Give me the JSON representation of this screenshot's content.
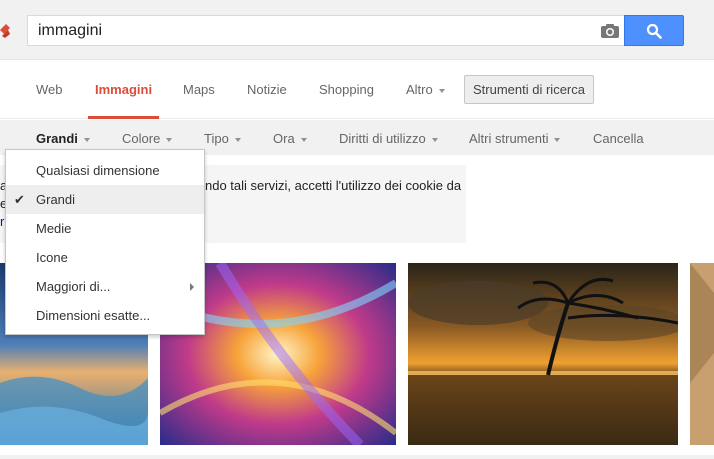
{
  "search": {
    "query": "immagini"
  },
  "icons": {
    "camera": "camera-icon",
    "search": "magnifier-icon",
    "check": "checkmark-icon",
    "submenu": "submenu-arrow-icon"
  },
  "colors": {
    "brand_blue": "#4d90fe",
    "active_tab": "#dd4b39",
    "link": "#1a0dab"
  },
  "nav": {
    "tabs": [
      {
        "label": "Web"
      },
      {
        "label": "Immagini",
        "active": true
      },
      {
        "label": "Maps"
      },
      {
        "label": "Notizie"
      },
      {
        "label": "Shopping"
      },
      {
        "label": "Altro"
      }
    ],
    "tools_button": "Strumenti di ricerca"
  },
  "filters": [
    {
      "label": "Grandi"
    },
    {
      "label": "Colore"
    },
    {
      "label": "Tipo"
    },
    {
      "label": "Ora"
    },
    {
      "label": "Diritti di utilizzo"
    },
    {
      "label": "Altri strumenti"
    },
    {
      "label": "Cancella"
    }
  ],
  "size_menu": {
    "items": [
      {
        "label": "Qualsiasi dimensione"
      },
      {
        "label": "Grandi",
        "selected": true
      },
      {
        "label": "Medie"
      },
      {
        "label": "Icone"
      },
      {
        "label": "Maggiori di..."
      },
      {
        "label": "Dimensioni esatte..."
      }
    ]
  },
  "cookie_notice": {
    "text": "ndo tali servizi, accetti l'utilizzo dei cookie da",
    "left_fragment_1": "a",
    "left_fragment_2": "e",
    "left_link": "r"
  }
}
